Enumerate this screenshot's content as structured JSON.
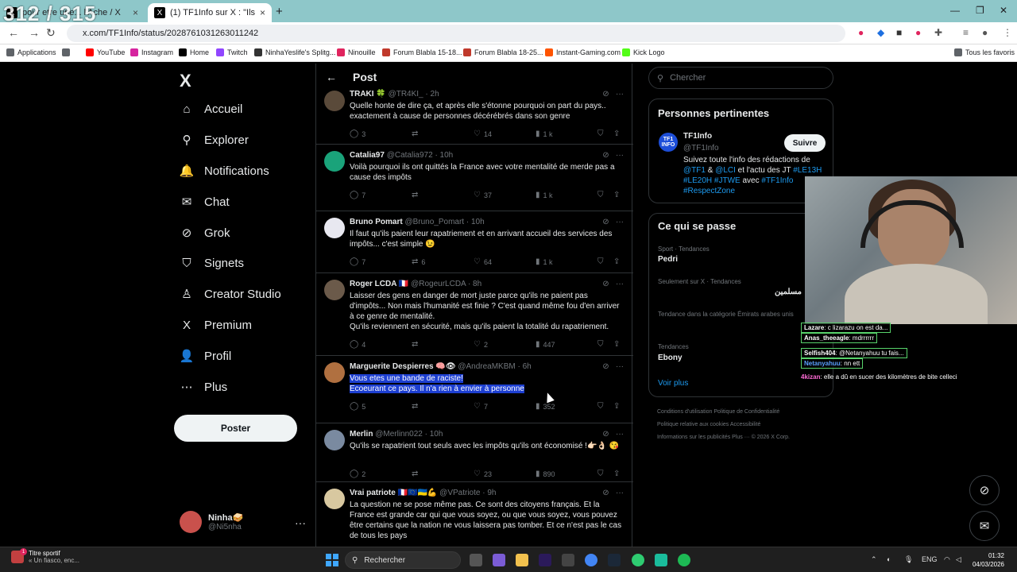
{
  "browser": {
    "counter": "312 / 315",
    "tabs": [
      {
        "label": "pour etre une... l'Ache / X",
        "close": "×"
      },
      {
        "label": "(1) TF1Info sur X : \"Ils Influencer...",
        "close": "×"
      }
    ],
    "new_tab": "+",
    "url": "x.com/TF1Info/status/2028761031263011242",
    "bookmarks": [
      {
        "label": "Applications",
        "color": "#5f6368"
      },
      {
        "label": "",
        "color": "#5f6368"
      },
      {
        "label": "YouTube",
        "color": "#ff0000"
      },
      {
        "label": "Instagram",
        "color": "#d6249f"
      },
      {
        "label": "Home",
        "color": "#000000"
      },
      {
        "label": "Twitch",
        "color": "#9146ff"
      },
      {
        "label": "NinhaYeslife's Splitg...",
        "color": "#333333"
      },
      {
        "label": "Ninouille",
        "color": "#e0245e"
      },
      {
        "label": "Forum Blabla 15-18...",
        "color": "#c0392b"
      },
      {
        "label": "Forum Blabla 18-25...",
        "color": "#c0392b"
      },
      {
        "label": "Instant-Gaming.com",
        "color": "#ff5400"
      },
      {
        "label": "Kick Logo",
        "color": "#53fc18"
      }
    ],
    "all_bookmarks": "Tous les favoris"
  },
  "sidebar": {
    "logo": "X",
    "items": [
      {
        "label": "Accueil",
        "icon": "⌂"
      },
      {
        "label": "Explorer",
        "icon": "⚲"
      },
      {
        "label": "Notifications",
        "icon": "🔔"
      },
      {
        "label": "Chat",
        "icon": "✉"
      },
      {
        "label": "Grok",
        "icon": "⊘"
      },
      {
        "label": "Signets",
        "icon": "⛉"
      },
      {
        "label": "Creator Studio",
        "icon": "♙"
      },
      {
        "label": "Premium",
        "icon": "X"
      },
      {
        "label": "Profil",
        "icon": "👤"
      },
      {
        "label": "Plus",
        "icon": "⋯"
      }
    ],
    "post_button": "Poster",
    "profile_name": "Ninha🥪",
    "profile_handle": "@Ni5nha",
    "profile_more": "···"
  },
  "center": {
    "back": "←",
    "title": "Post",
    "posts": [
      {
        "name": "TRAKI 🍀",
        "handle": "@TR4KI_",
        "time": "· 2h",
        "text": "Quelle honte de dire ça, et après elle s'étonne pourquoi on part du pays.. exactement à cause de personnes décérébrés dans son genre",
        "replies": "3",
        "retweets": "",
        "likes": "14",
        "views": "1 k",
        "avatar": "#5a4a3a"
      },
      {
        "name": "Catalia97",
        "handle": "@Catalia972",
        "time": "· 10h",
        "text": "Voilà pourquoi ils ont quittés la France avec votre mentalité de merde pas a cause des impôts",
        "replies": "7",
        "retweets": "",
        "likes": "37",
        "views": "1 k",
        "avatar": "#1aa37a"
      },
      {
        "name": "Bruno Pomart",
        "handle": "@Bruno_Pomart",
        "time": "· 10h",
        "text": "Il faut qu'ils paient leur rapatriement et en arrivant accueil des services des impôts... c'est simple 😉",
        "replies": "7",
        "retweets": "6",
        "likes": "64",
        "views": "1 k",
        "avatar": "#e8e8f0"
      },
      {
        "name": "Roger LCDA 🇫🇷",
        "handle": "@RogeurLCDA",
        "time": "· 8h",
        "text": "Laisser des gens en danger de mort juste parce qu'ils ne paient pas d'impôts... Non mais l'humanité est finie ? C'est quand même fou d'en arriver à ce genre de mentalité.\nQu'ils reviennent en sécurité, mais qu'ils paient la totalité du rapatriement.",
        "replies": "4",
        "retweets": "",
        "likes": "2",
        "views": "447",
        "avatar": "#6b5a4a"
      },
      {
        "name": "Marguerite Despierres 🧠👁",
        "handle": "@AndreaMKBM",
        "time": "· 6h",
        "text1": "Vous etes une bande de raciste!",
        "text2": "Ecoeurant ce pays. Il n'a rien à envier à personne",
        "replies": "5",
        "retweets": "",
        "likes": "7",
        "views": "352",
        "avatar": "#b07040"
      },
      {
        "name": "Merlin",
        "handle": "@Merlinn022",
        "time": "· 10h",
        "text": "Qu'ils se rapatrient tout seuls avec les impôts qu'ils ont économisé !👉🏻👌🏻 😘",
        "replies": "2",
        "retweets": "",
        "likes": "23",
        "views": "890",
        "avatar": "#7a8aa0"
      },
      {
        "name": "Vrai patriote 🇫🇷🇪🇺🇺🇦💪",
        "handle": "@VPatriote",
        "time": "· 9h",
        "text": "La question ne se pose même pas. Ce sont des citoyens français. Et la France est grande car qui que vous soyez, ou que vous soyez, vous pouvez être certains que la nation ne vous laissera pas tomber. Et ce n'est pas le cas de tous les pays",
        "replies": "",
        "retweets": "",
        "likes": "",
        "views": "",
        "avatar": "#d8c8a0"
      }
    ]
  },
  "right": {
    "search_placeholder": "Chercher",
    "related_title": "Personnes pertinentes",
    "tf1_logo": "TF1 INFO",
    "tf1_name": "TF1Info",
    "tf1_handle": "@TF1Info",
    "follow": "Suivre",
    "bio_1": "Suivez toute l'info des rédactions de ",
    "bio_tf1": "@TF1",
    "bio_and": " & ",
    "bio_lci": "@LCI",
    "bio_2": " et l'actu des JT ",
    "bio_tags1": "#LE13H #LE20H #JTWE",
    "bio_avec": " avec ",
    "bio_tags2": "#TF1Info",
    "bio_tags3": "#RespectZone",
    "trends_title": "Ce qui se passe",
    "trends": [
      {
        "meta": "Sport · Tendances",
        "name": "Pedri"
      },
      {
        "meta": "Seulement sur X · Tendances",
        "name": "مسلمين"
      },
      {
        "meta": "Tendance dans la catégorie Émirats arabes unis",
        "name": ""
      },
      {
        "meta": "Tendances",
        "name": "Ebony"
      }
    ],
    "voir_plus": "Voir plus",
    "footer_1": "Conditions d'utilisation    Politique de Confidentialité",
    "footer_2": "Politique relative aux cookies    Accessibilité",
    "footer_3": "Informations sur les publicités    Plus ···    © 2026 X Corp."
  },
  "overlay_chat": [
    {
      "user": "Lazare",
      "text": ": c lizarazu on est da..."
    },
    {
      "user": "Anas_theeagle",
      "text": ": mdrrrrrr"
    },
    {
      "user": "Selfish404",
      "text": ": @Netanyahuu tu fais..."
    },
    {
      "user": "Netanyahuu",
      "text": ": nn ett"
    },
    {
      "user": "4kizan",
      "text": ": elle a dû en sucer des kilomètres de bite celleci"
    }
  ],
  "taskbar": {
    "notif_title": "Titre sportif",
    "notif_sub": "« Un fiasco, enc...",
    "search": "Rechercher",
    "lang": "ENG",
    "time": "01:32",
    "date": "04/03/2026"
  }
}
